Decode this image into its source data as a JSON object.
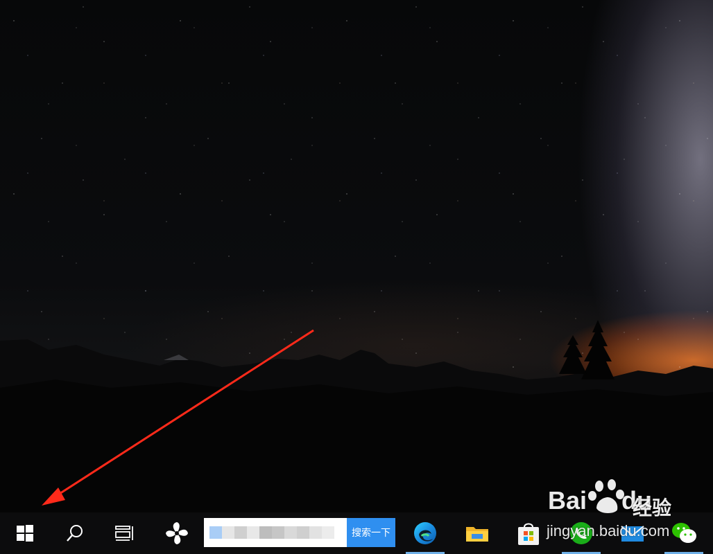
{
  "wallpaper": {
    "description_colors": {
      "sky": "#0b0c0e",
      "horizon_glow": "#ff7a1a",
      "milky_way": "#c8c3dc"
    }
  },
  "watermark": {
    "brand": "Bai",
    "brand_suffix": "du",
    "chinese": "经验",
    "url": "jingyan.baidu.com"
  },
  "taskbar": {
    "background": "#0c0c0d",
    "accent": "#6fb0e8",
    "start_icon": "windows-logo-icon",
    "search_icon": "magnifier-icon",
    "taskview_icon": "task-view-icon",
    "pinned_app_icon": "pinwheel-icon",
    "search_box": {
      "value": "",
      "button_label": "搜索一下",
      "button_color": "#2f8ff0"
    },
    "apps": [
      {
        "name": "edge-icon",
        "active": true
      },
      {
        "name": "file-explorer-icon",
        "active": false
      },
      {
        "name": "store-icon",
        "active": false
      },
      {
        "name": "wechat-call-icon",
        "active": true
      },
      {
        "name": "mail-icon",
        "active": false
      },
      {
        "name": "wechat-icon",
        "active": true
      }
    ]
  }
}
